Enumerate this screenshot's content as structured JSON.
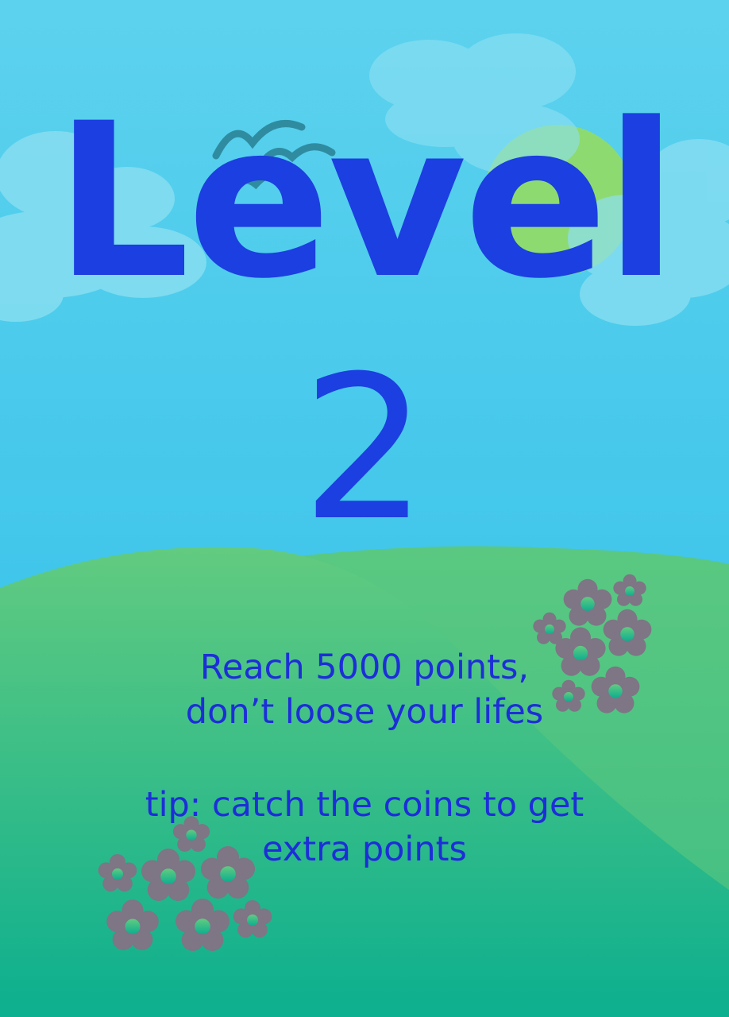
{
  "level": {
    "title": "Level",
    "number": "2"
  },
  "instructions": {
    "goal_line_1": "Reach 5000 points,",
    "goal_line_2": "don’t loose your lifes",
    "tip_line_1": "tip: catch the coins to get",
    "tip_line_2": "extra points"
  },
  "colors": {
    "sky_top": "#5dd2ee",
    "sky_bottom": "#2fbfe8",
    "hill_back": "#56c585",
    "hill_front_top": "#5fca80",
    "hill_front_bottom": "#0fb08e",
    "sun": "#8ddb70",
    "cloud": "#8ee0f2",
    "bird": "#2f8ca0",
    "flower": "#7e7585",
    "title_text": "#1b3fe0",
    "info_text": "#1d2ed8"
  }
}
